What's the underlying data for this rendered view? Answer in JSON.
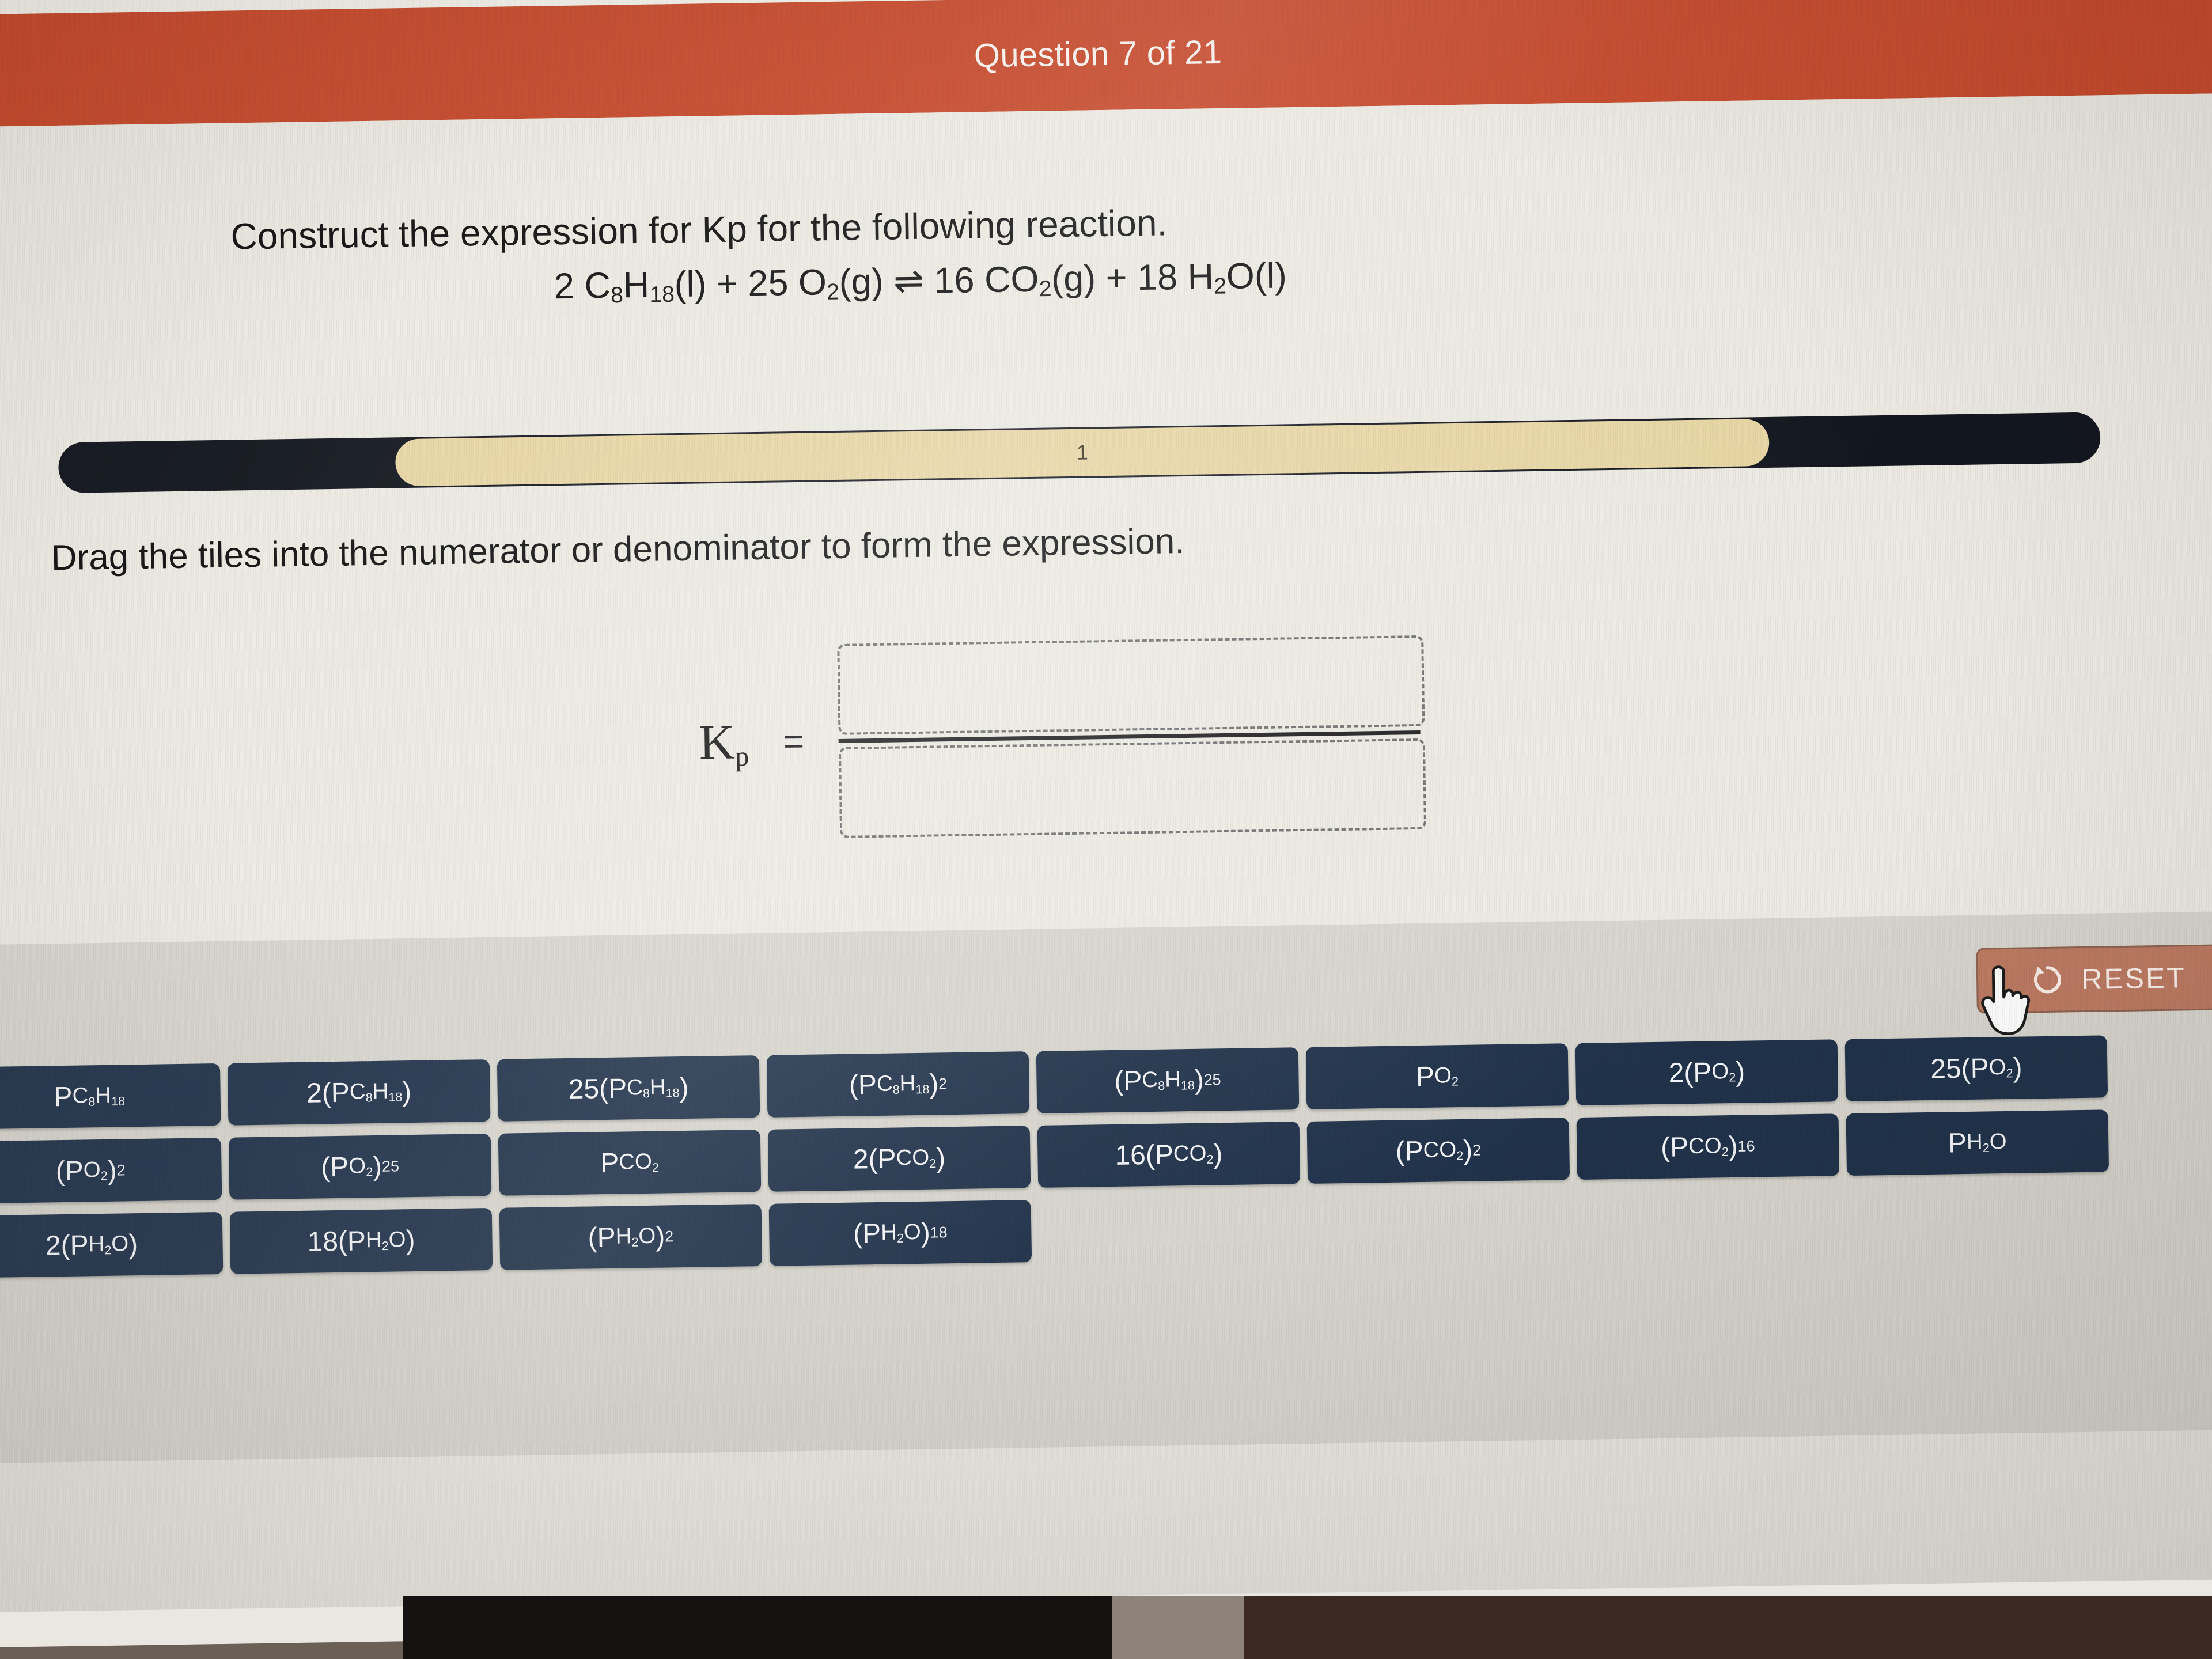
{
  "header": {
    "title": "Question 7 of 21"
  },
  "question": {
    "prompt": "Construct the expression for Kp for the following reaction.",
    "equation_plain": "2 C8H18(l) + 25 O2(g) ⇌ 16 CO2(g) + 18 H2O(l)",
    "equation_parts": {
      "coef_a": "2 ",
      "reactant1": "C",
      "reactant1_sub1": "8",
      "reactant1_h": "H",
      "reactant1_sub2": "18",
      "reactant1_state": "(l) + 25 O",
      "o2_sub": "2",
      "o2_state": "(g) ",
      "arrow": "⇌",
      "products": " 16 CO",
      "co2_sub": "2",
      "co2_state": "(g) + 18 H",
      "h2o_sub": "2",
      "h2o_state": "O(l)"
    }
  },
  "progress": {
    "label": "1",
    "fill_percent": 67
  },
  "instruction": {
    "text": "Drag the tiles into the numerator or denominator to form the expression."
  },
  "expression": {
    "kp_k": "K",
    "kp_sub": "p",
    "equals": "=",
    "numerator_value": "",
    "denominator_value": ""
  },
  "toolbar": {
    "reset_label": "RESET",
    "reset_icon": "undo-arrow-icon",
    "cursor_icon": "pointing-hand-cursor"
  },
  "tiles": {
    "rows": [
      [
        {
          "id": "p-c8h18",
          "parts": {
            "base": "P",
            "sub1": "C",
            "sub2": "8",
            "sub3": "H",
            "sub4": "18"
          },
          "plain": "PC8H18"
        },
        {
          "id": "2-p-c8h18",
          "plain": "2(PC8H18)"
        },
        {
          "id": "25-p-c8h18",
          "plain": "25(PC8H18)"
        },
        {
          "id": "p-c8h18-pow2",
          "plain": "(PC8H18)2"
        },
        {
          "id": "p-c8h18-pow25",
          "plain": "(PC8H18)25"
        },
        {
          "id": "p-o2",
          "plain": "PO2"
        },
        {
          "id": "2-p-o2",
          "plain": "2(PO2)"
        },
        {
          "id": "25-p-o2",
          "plain": "25(PO2)"
        }
      ],
      [
        {
          "id": "p-o2-pow2",
          "plain": "(PO2)2"
        },
        {
          "id": "p-o2-pow25",
          "plain": "(PO2)25"
        },
        {
          "id": "p-co2",
          "plain": "PCO2"
        },
        {
          "id": "2-p-co2",
          "plain": "2(PCO2)"
        },
        {
          "id": "16-p-co2",
          "plain": "16(PCO2)"
        },
        {
          "id": "p-co2-pow2",
          "plain": "(PCO2)2"
        },
        {
          "id": "p-co2-pow16",
          "plain": "(PCO2)16"
        },
        {
          "id": "p-h2o",
          "plain": "PH2O"
        }
      ],
      [
        {
          "id": "2-p-h2o",
          "plain": "2(PH2O)"
        },
        {
          "id": "18-p-h2o",
          "plain": "18(PH2O)"
        },
        {
          "id": "p-h2o-pow2",
          "plain": "(PH2O)2"
        },
        {
          "id": "p-h2o-pow18",
          "plain": "(PH2O)18"
        }
      ]
    ]
  },
  "colors": {
    "header_red": "#c74a2c",
    "page_bg": "#eceae2",
    "tray_bg": "#d7d5cd",
    "tile_navy": "#20324a",
    "progress_track": "#12161e",
    "progress_fill": "#e8d6a4",
    "reset_bg": "#bd7a62"
  }
}
